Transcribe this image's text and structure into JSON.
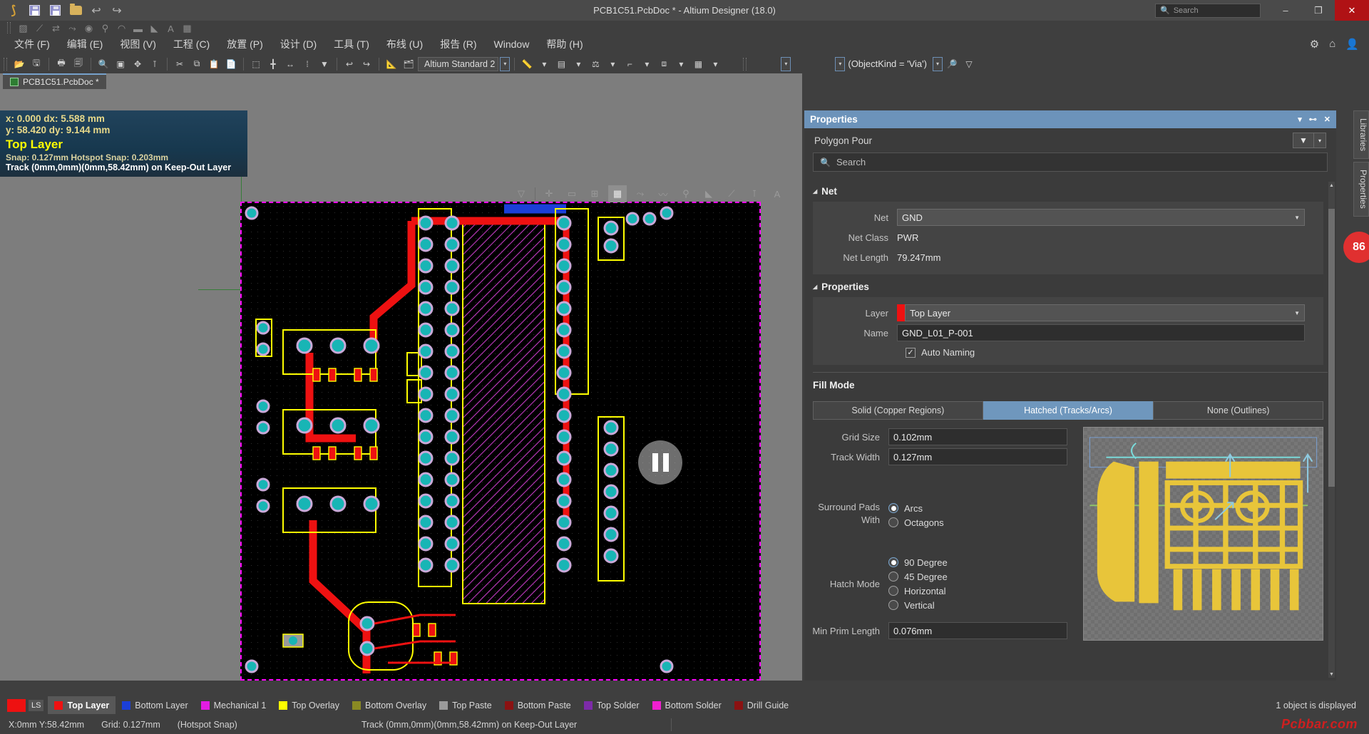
{
  "titlebar": {
    "title": "PCB1C51.PcbDoc * - Altium Designer (18.0)",
    "search_placeholder": "Search",
    "search_icon": "search-icon",
    "minimize": "–",
    "maximize": "❐",
    "close": "✕"
  },
  "menubar": {
    "items": [
      {
        "label": "文件 (F)"
      },
      {
        "label": "编辑 (E)"
      },
      {
        "label": "视图 (V)"
      },
      {
        "label": "工程 (C)"
      },
      {
        "label": "放置 (P)"
      },
      {
        "label": "设计 (D)"
      },
      {
        "label": "工具 (T)"
      },
      {
        "label": "布线 (U)"
      },
      {
        "label": "报告 (R)"
      },
      {
        "label": "Window"
      },
      {
        "label": "帮助 (H)"
      }
    ],
    "right_icons": [
      "gear-icon",
      "bell-icon",
      "user-icon"
    ]
  },
  "toolbar": {
    "standard_combo": "Altium Standard 2",
    "object_filter": "(ObjectKind = 'Via')"
  },
  "document_tab": {
    "label": "PCB1C51.PcbDoc *"
  },
  "canvas_info": {
    "line1": "x:  0.000    dx:  5.588 mm",
    "line2": "y: 58.420    dy:  9.144 mm",
    "layer": "Top Layer",
    "snap": "Snap: 0.127mm Hotspot Snap: 0.203mm",
    "track": "Track (0mm,0mm)(0mm,58.42mm) on Keep-Out Layer"
  },
  "panel": {
    "title": "Properties",
    "object_type": "Polygon Pour",
    "search_placeholder": "Search",
    "sections": {
      "net": {
        "title": "Net",
        "net_label": "Net",
        "net_value": "GND",
        "net_class_label": "Net Class",
        "net_class_value": "PWR",
        "net_length_label": "Net Length",
        "net_length_value": "79.247mm"
      },
      "properties": {
        "title": "Properties",
        "layer_label": "Layer",
        "layer_value": "Top Layer",
        "layer_color": "#ee1111",
        "name_label": "Name",
        "name_value": "GND_L01_P-001",
        "auto_naming_label": "Auto Naming",
        "auto_naming_checked": "✓"
      },
      "fill_mode": {
        "title": "Fill Mode",
        "options": [
          {
            "label": "Solid (Copper Regions)",
            "selected": false
          },
          {
            "label": "Hatched (Tracks/Arcs)",
            "selected": true
          },
          {
            "label": "None (Outlines)",
            "selected": false
          }
        ],
        "grid_size_label": "Grid Size",
        "grid_size_value": "0.102mm",
        "track_width_label": "Track Width",
        "track_width_value": "0.127mm",
        "surround_label_1": "Surround Pads",
        "surround_label_2": "With",
        "surround_options": [
          {
            "label": "Arcs",
            "selected": true
          },
          {
            "label": "Octagons",
            "selected": false
          }
        ],
        "hatch_mode_label": "Hatch Mode",
        "hatch_options": [
          {
            "label": "90 Degree",
            "selected": true
          },
          {
            "label": "45 Degree",
            "selected": false
          },
          {
            "label": "Horizontal",
            "selected": false
          },
          {
            "label": "Vertical",
            "selected": false
          }
        ],
        "min_prim_label": "Min Prim Length",
        "min_prim_value": "0.076mm"
      }
    }
  },
  "edge_tabs": [
    {
      "label": "Libraries"
    },
    {
      "label": "Properties"
    }
  ],
  "badge": {
    "value": "86"
  },
  "layer_tabs": {
    "ls_label": "LS",
    "items": [
      {
        "label": "Top Layer",
        "color": "#ee1111",
        "selected": true
      },
      {
        "label": "Bottom Layer",
        "color": "#1b3fd8",
        "selected": false
      },
      {
        "label": "Mechanical 1",
        "color": "#e21ce2",
        "selected": false
      },
      {
        "label": "Top Overlay",
        "color": "#ffff00",
        "selected": false
      },
      {
        "label": "Bottom Overlay",
        "color": "#8a8a23",
        "selected": false
      },
      {
        "label": "Top Paste",
        "color": "#9a9a9a",
        "selected": false
      },
      {
        "label": "Bottom Paste",
        "color": "#8b1212",
        "selected": false
      },
      {
        "label": "Top Solder",
        "color": "#7d2ba8",
        "selected": false
      },
      {
        "label": "Bottom Solder",
        "color": "#f020d0",
        "selected": false
      },
      {
        "label": "Drill Guide",
        "color": "#8b1212",
        "selected": false
      }
    ],
    "object_status": "1 object is displayed"
  },
  "statusbar": {
    "coords": "X:0mm Y:58.42mm",
    "grid": "Grid: 0.127mm",
    "snap_mode": "(Hotspot Snap)",
    "track_info": "Track (0mm,0mm)(0mm,58.42mm) on Keep-Out Layer",
    "watermark": "Pcbbar.com"
  }
}
